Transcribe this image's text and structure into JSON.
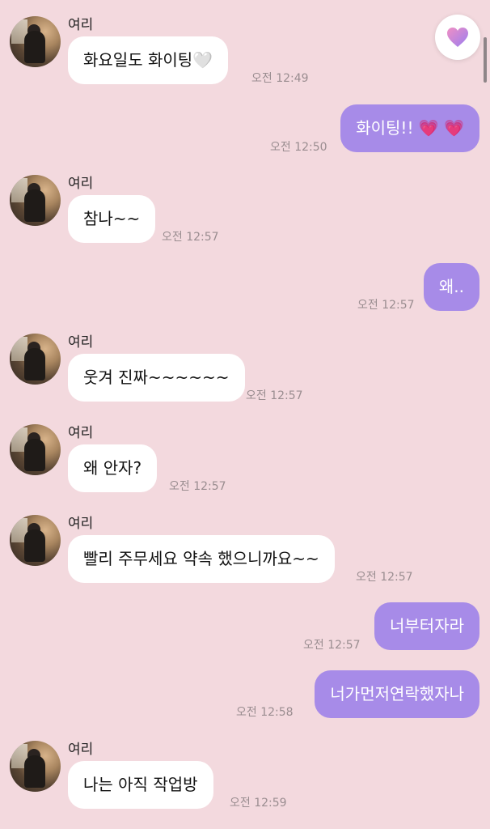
{
  "sender_name": "여리",
  "messages": [
    {
      "dir": "in",
      "text": "화요일도 화이팅🤍",
      "time": "오전 12:49"
    },
    {
      "dir": "out",
      "text": "화이팅!! 💗 💗",
      "time": "오전 12:50"
    },
    {
      "dir": "in",
      "text": "참나~~",
      "time": "오전 12:57"
    },
    {
      "dir": "out",
      "text": "왜..",
      "time": "오전 12:57"
    },
    {
      "dir": "in",
      "text": "웃겨 진짜~~~~~~",
      "time": "오전 12:57"
    },
    {
      "dir": "in",
      "text": "왜 안자?",
      "time": "오전 12:57"
    },
    {
      "dir": "in",
      "text": "빨리 주무세요 약속 했으니까요~~",
      "time": "오전 12:57"
    },
    {
      "dir": "out",
      "text": "너부터자라",
      "time": "오전 12:57"
    },
    {
      "dir": "out",
      "text": "너가먼저연락했자나",
      "time": "오전 12:58"
    },
    {
      "dir": "in",
      "text": "나는 아직 작업방",
      "time": "오전 12:59"
    }
  ],
  "icons": {
    "favorite": "heart-icon",
    "avatar": "profile-photo"
  },
  "colors": {
    "background": "#f3d9de",
    "sent_bubble": "#a78be8",
    "received_bubble": "#ffffff",
    "timestamp": "#9a8d90"
  }
}
